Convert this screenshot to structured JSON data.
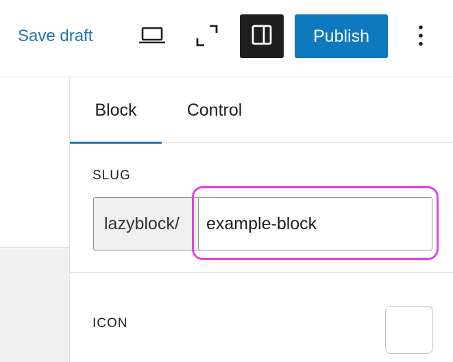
{
  "header": {
    "save_draft_label": "Save draft",
    "publish_label": "Publish",
    "icons": [
      "laptop-icon",
      "fullscreen-icon",
      "sidebar-toggle-icon",
      "more-vertical-icon"
    ]
  },
  "sidebar": {
    "tabs": [
      {
        "label": "Block",
        "active": true
      },
      {
        "label": "Control",
        "active": false
      }
    ],
    "slug": {
      "label": "SLUG",
      "prefix": "lazyblock/",
      "value": "example-block"
    },
    "icon": {
      "label": "ICON"
    }
  },
  "colors": {
    "accent": "#1f73b1",
    "publish": "#0d7abf",
    "highlight": "#e440e8",
    "dark_button": "#1e1e1e"
  }
}
